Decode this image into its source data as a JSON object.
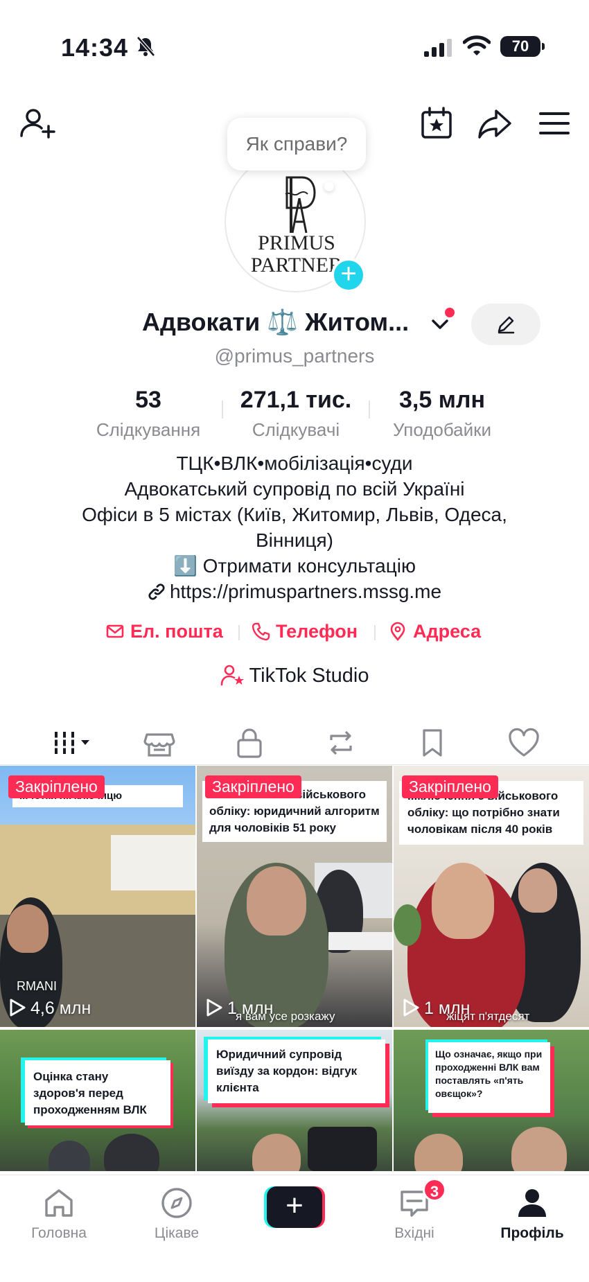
{
  "status_bar": {
    "time": "14:34",
    "battery": "70"
  },
  "bubble": {
    "text": "Як справи?"
  },
  "avatar": {
    "brand_line1": "PRIMUS",
    "brand_line2": "PARTNER"
  },
  "profile": {
    "name": "Адвокати ⚖️ Житом...",
    "handle": "@primus_partners"
  },
  "stats": [
    {
      "value": "53",
      "label": "Слідкування"
    },
    {
      "value": "271,1 тис.",
      "label": "Слідкувачі"
    },
    {
      "value": "3,5 млн",
      "label": "Уподобайки"
    }
  ],
  "bio": {
    "line1": "ТЦК•ВЛК•мобілізація•суди",
    "line2": "Адвокатський супровід по всій Україні",
    "line3": "Офіси в 5 містах (Київ, Житомир, Львів, Одеса,",
    "line4": "Вінниця)",
    "line5": "⬇️ Отримати консультацію",
    "link": "https://primuspartners.mssg.me"
  },
  "contacts": {
    "email": "Ел. пошта",
    "phone": "Телефон",
    "address": "Адреса"
  },
  "studio": {
    "label": "TikTok Studio"
  },
  "videos": [
    {
      "pinned": "Закріплено",
      "caption": "...чотки як ключицю",
      "views": "4,6 млн",
      "overlay": "RMANI"
    },
    {
      "pinned": "Закріплено",
      "caption": "...ключитися з військового обліку: юридичний алгоритм для чоловіків 51 року",
      "views": "1 млн",
      "overlay": "я вам усе розкажу"
    },
    {
      "pinned": "Закріплено",
      "caption": "...ключення з військового обліку: що потрібно знати чоловікам після 40 років",
      "views": "1 млн",
      "overlay": "жіцят п'ятдесят"
    },
    {
      "caption": "Оцінка стану здоров'я перед проходженням ВЛК"
    },
    {
      "caption": "Юридичний супровід виїзду за кордон: відгук клієнта"
    },
    {
      "caption": "Що означає, якщо при проходженні ВЛК вам поставлять «п'ять овєщок»?"
    }
  ],
  "nav": {
    "home": "Головна",
    "discover": "Цікаве",
    "inbox": "Вхідні",
    "inbox_badge": "3",
    "profile": "Профіль"
  },
  "colors": {
    "accent": "#fe2c55",
    "cyan": "#25f4ee",
    "text": "#161823",
    "muted": "#8a8b91"
  }
}
